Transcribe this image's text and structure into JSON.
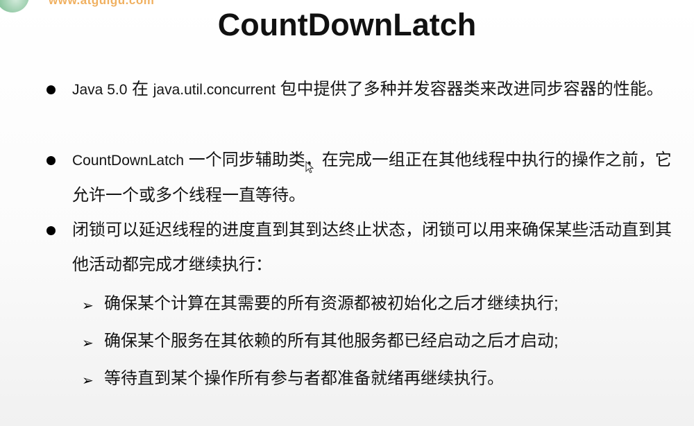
{
  "watermark": {
    "url": "www.atguigu.com"
  },
  "slide": {
    "title": "CountDownLatch",
    "bullets": [
      {
        "parts": [
          "Java 5.0",
          " 在 ",
          "java.util.concurrent",
          " 包中提供了多种并发容器类来改进同步容器的性能。"
        ]
      },
      {
        "parts": [
          "CountDownLatch",
          " 一个同步辅助类，在完成一组正在其他线程中执行的操作之前，它允许一个或多个线程一直等待。"
        ]
      },
      {
        "text": "闭锁可以延迟线程的进度直到其到达终止状态，闭锁可以用来确保某些活动直到其他活动都完成才继续执行："
      }
    ],
    "sub_bullets": [
      "确保某个计算在其需要的所有资源都被初始化之后才继续执行;",
      "确保某个服务在其依赖的所有其他服务都已经启动之后才启动;",
      "等待直到某个操作所有参与者都准备就绪再继续执行。"
    ],
    "bullet_icon": "filled-circle",
    "sub_bullet_icon": "arrow-right-hollow"
  }
}
